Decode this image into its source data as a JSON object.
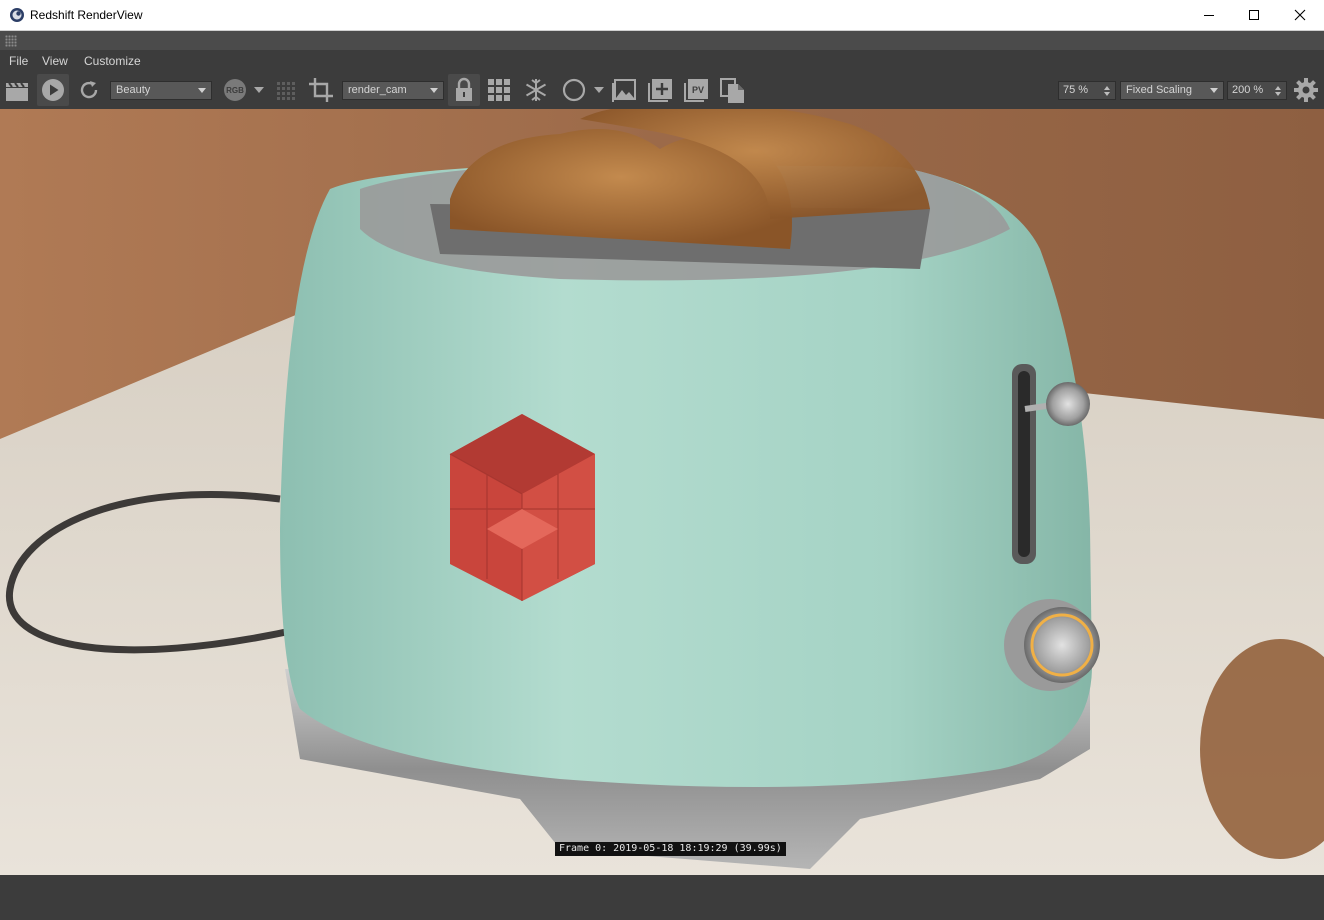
{
  "window": {
    "title": "Redshift RenderView"
  },
  "menu": {
    "items": [
      "File",
      "View",
      "Customize"
    ]
  },
  "toolbar": {
    "aov_select": "Beauty",
    "channel_badge": "RGB",
    "camera_select": "render_cam",
    "zoom_value": "75 %",
    "scaling_select": "Fixed Scaling",
    "scale_value": "200 %",
    "pv_badge": "PV"
  },
  "render": {
    "frame_info": "Frame 0: 2019-05-18 18:19:29 (39.99s)"
  },
  "colors": {
    "toaster_body": "#a9d6c8",
    "logo_red": "#c9453c",
    "ui_dark": "#3c3c3c"
  }
}
